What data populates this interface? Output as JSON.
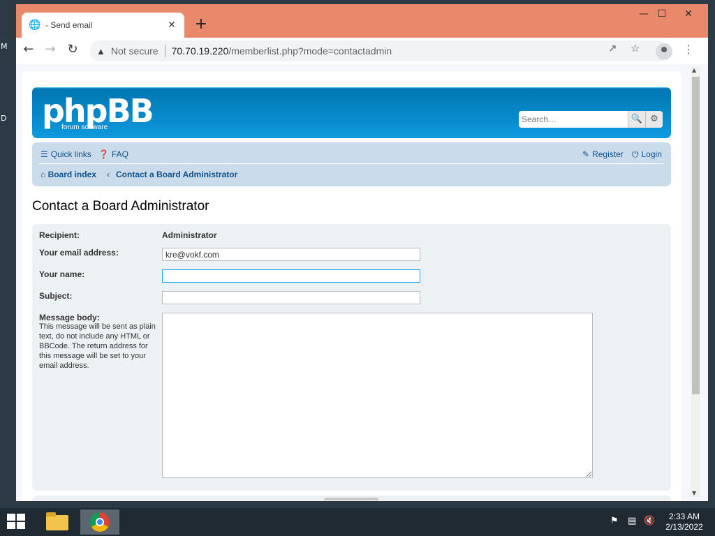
{
  "desktop": {
    "edge_letters": [
      "M",
      "D"
    ]
  },
  "browser": {
    "tab": {
      "title": "- Send email",
      "close_icon": "close-icon"
    },
    "new_tab_label": "+",
    "window_controls": {
      "minimize": "—",
      "maximize": "☐",
      "close": "✕"
    },
    "toolbar": {
      "back": "←",
      "forward": "→",
      "reload": "↻",
      "security_label": "Not secure",
      "url_host": "70.70.19.220",
      "url_path": "/memberlist.php?mode=contactadmin"
    }
  },
  "site": {
    "logo_text": "phpBB",
    "logo_sub": "forum software",
    "search_placeholder": "Search…",
    "nav": {
      "quick_links": "Quick links",
      "faq": "FAQ",
      "register": "Register",
      "login": "Login"
    },
    "breadcrumbs": [
      "Board index",
      "Contact a Board Administrator"
    ],
    "page_title": "Contact a Board Administrator"
  },
  "form": {
    "recipient_label": "Recipient:",
    "recipient_value": "Administrator",
    "email_label": "Your email address:",
    "email_value": "kre@vokf.com",
    "name_label": "Your name:",
    "name_value": "",
    "subject_label": "Subject:",
    "subject_value": "",
    "message_label": "Message body:",
    "message_help": "This message will be sent as plain text, do not include any HTML or BBCode. The return address for this message will be set to your email address.",
    "message_value": ""
  },
  "taskbar": {
    "time": "2:33 AM",
    "date": "2/13/2022"
  },
  "colors": {
    "window_frame": "#e9886a",
    "header_blue": "#12a3eb",
    "navbar": "#cadceb",
    "link": "#105289",
    "panel": "#ecf1f3"
  }
}
